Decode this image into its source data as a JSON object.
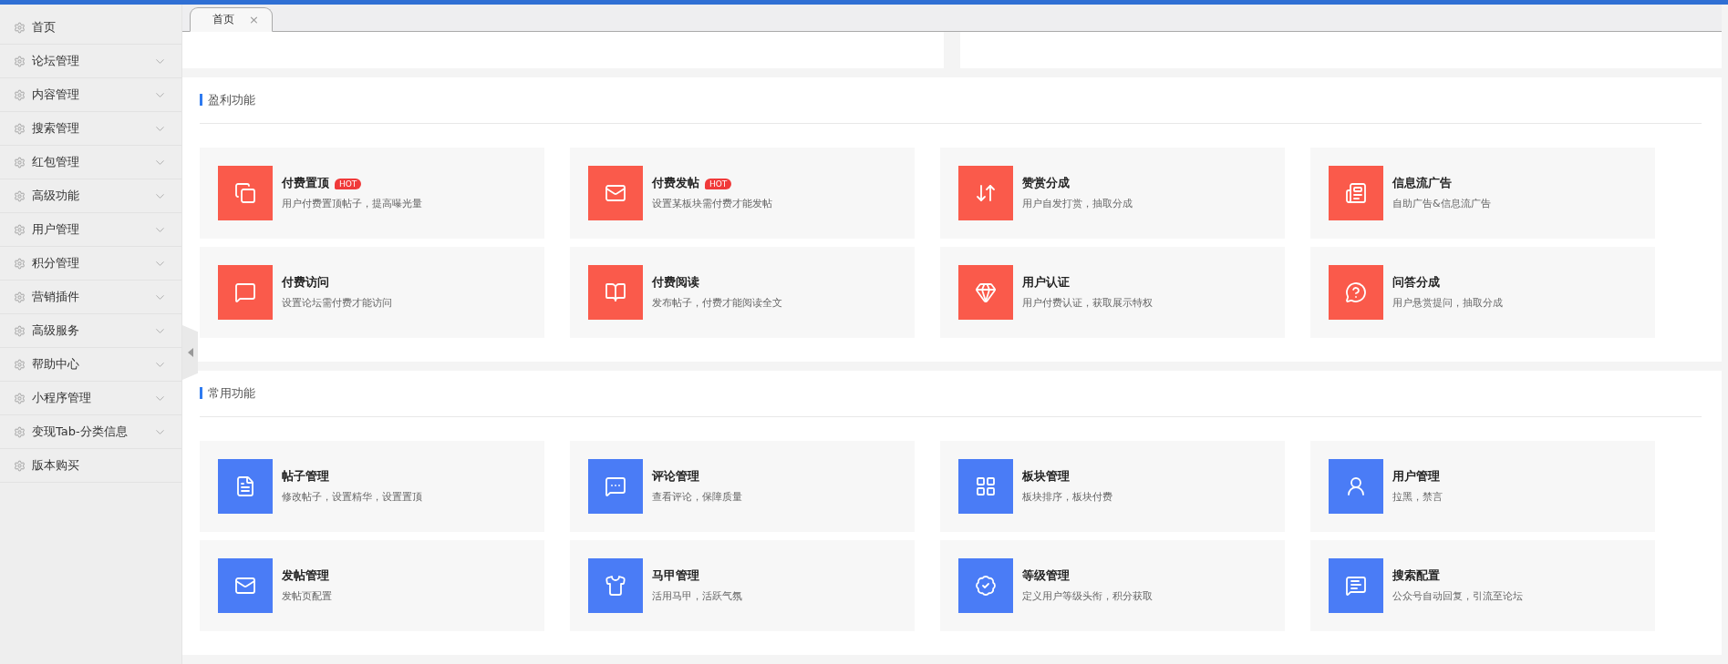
{
  "sidebar": {
    "items": [
      {
        "label": "首页",
        "expandable": false
      },
      {
        "label": "论坛管理",
        "expandable": true
      },
      {
        "label": "内容管理",
        "expandable": true
      },
      {
        "label": "搜索管理",
        "expandable": true
      },
      {
        "label": "红包管理",
        "expandable": true
      },
      {
        "label": "高级功能",
        "expandable": true
      },
      {
        "label": "用户管理",
        "expandable": true
      },
      {
        "label": "积分管理",
        "expandable": true
      },
      {
        "label": "营销插件",
        "expandable": true
      },
      {
        "label": "高级服务",
        "expandable": true
      },
      {
        "label": "帮助中心",
        "expandable": true
      },
      {
        "label": "小程序管理",
        "expandable": true
      },
      {
        "label": "变现Tab-分类信息",
        "expandable": true
      },
      {
        "label": "版本购买",
        "expandable": false
      }
    ]
  },
  "tabs": [
    {
      "label": "首页",
      "close": "×",
      "selected": true
    }
  ],
  "sections": [
    {
      "title": "盈利功能",
      "color": "#fa5a4b",
      "cards": [
        {
          "title": "付费置顶",
          "badge": "HOT",
          "description": "用户付费置顶帖子，提高曝光量"
        },
        {
          "title": "付费发帖",
          "badge": "HOT",
          "description": "设置某板块需付费才能发帖"
        },
        {
          "title": "赞赏分成",
          "description": "用户自发打赏，抽取分成"
        },
        {
          "title": "信息流广告",
          "description": "自助广告&信息流广告"
        },
        {
          "title": "付费访问",
          "description": "设置论坛需付费才能访问"
        },
        {
          "title": "付费阅读",
          "description": "发布帖子，付费才能阅读全文"
        },
        {
          "title": "用户认证",
          "description": "用户付费认证，获取展示特权"
        },
        {
          "title": "问答分成",
          "description": "用户悬赏提问，抽取分成"
        }
      ]
    },
    {
      "title": "常用功能",
      "color": "#4a7cf6",
      "cards": [
        {
          "title": "帖子管理",
          "description": "修改帖子，设置精华，设置置顶"
        },
        {
          "title": "评论管理",
          "description": "查看评论，保障质量"
        },
        {
          "title": "板块管理",
          "description": "板块排序，板块付费"
        },
        {
          "title": "用户管理",
          "description": "拉黑，禁言"
        },
        {
          "title": "发帖管理",
          "description": "发帖页配置"
        },
        {
          "title": "马甲管理",
          "description": "活用马甲，活跃气氛"
        },
        {
          "title": "等级管理",
          "description": "定义用户等级头衔，积分获取"
        },
        {
          "title": "搜索配置",
          "description": "公众号自动回复，引流至论坛"
        }
      ]
    }
  ]
}
